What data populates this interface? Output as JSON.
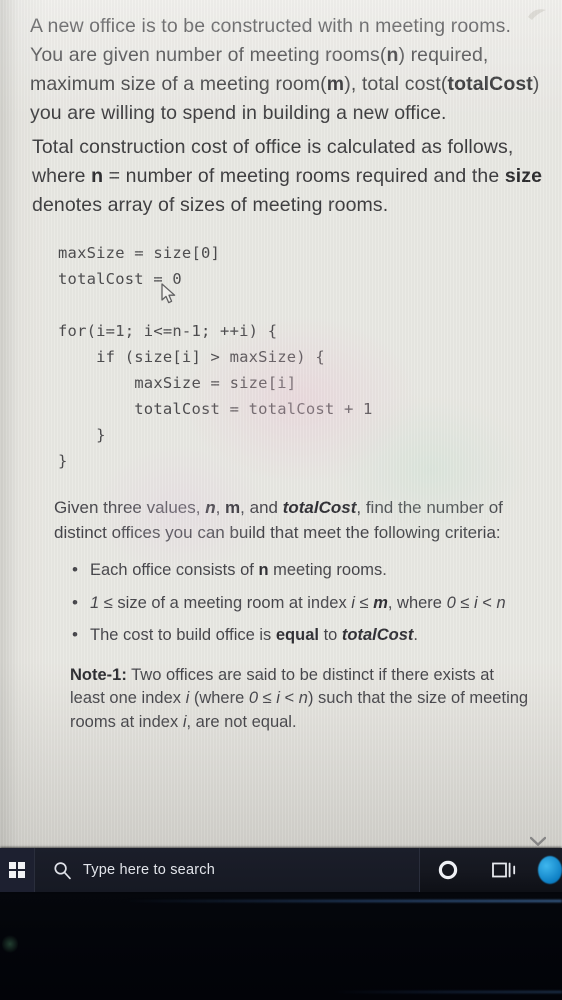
{
  "document": {
    "paragraph_intro_html": "A new office is to be constructed with n meeting rooms. You are given number of meeting rooms(<b>n</b>) required, maximum size of a meeting room(<b>m</b>), total cost(<b>totalCost</b>) you are willing to spend in building a new office.",
    "paragraph_formula_html": "Total construction cost of office is calculated as follows, where <b>n</b> = number of meeting rooms required and the <b>size</b> denotes array of sizes of meeting rooms.",
    "code": "maxSize = size[0]\ntotalCost = 0\n\nfor(i=1; i<=n-1; ++i) {\n    if (size[i] > maxSize) {\n        maxSize = size[i]\n        totalCost = totalCost + 1\n    }\n}",
    "paragraph_given_html": "Given three values, <span class=\"bi\">n</span>, <b>m</b>, and <span class=\"bi\">totalCost</span>, find the number of distinct offices you can build that meet the following criteria:",
    "criteria": [
      {
        "html": "Each office consists of <b>n</b> meeting rooms."
      },
      {
        "html": "<i>1</i> ≤ size of a meeting room at index <i>i</i> ≤ <span class=\"bi\">m</span>, where <i>0</i> ≤ <i>i</i> &lt; <i>n</i>"
      },
      {
        "html": "The cost to build office is <b>equal</b> to <span class=\"bi\">totalCost</span>."
      }
    ],
    "note_html": "<b>Note-1:</b> Two offices are said to be distinct if there exists at least one index <i>i</i> (where <i>0</i> ≤ <i>i</i> &lt; <i>n</i>) such that the size of meeting rooms at index <i>i</i>, are not equal.",
    "scroll_down_indicator": "▾"
  },
  "taskbar": {
    "start_label": "Start",
    "search_placeholder": "Type here to search",
    "cortana_label": "Cortana",
    "task_view_label": "Task View",
    "edge_label": "Microsoft Edge"
  },
  "colors": {
    "page_background": "#e9e8e3",
    "body_text": "#45454a",
    "heading_text": "#2f2f34",
    "taskbar_background": "#15171f",
    "taskbar_text": "#e2e4ea",
    "edge_blue": "#0d7fc4"
  }
}
